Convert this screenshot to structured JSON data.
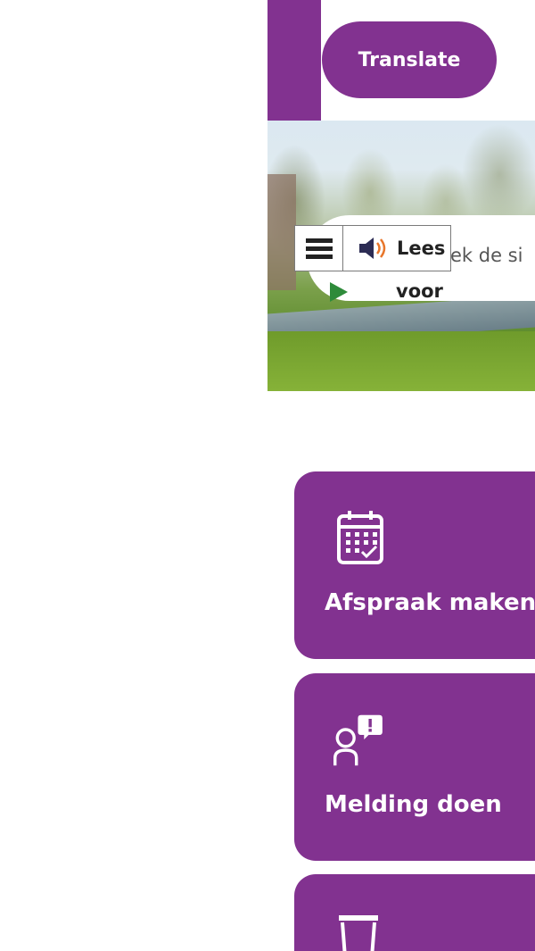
{
  "header": {
    "translate_label": "Translate"
  },
  "hero": {
    "search_placeholder": "ek de si"
  },
  "readspeaker": {
    "label_line1": "Lees",
    "label_line2": "voor"
  },
  "tiles": [
    {
      "label": "Afspraak maken",
      "icon": "calendar-icon"
    },
    {
      "label": "Melding doen",
      "icon": "person-alert-icon"
    },
    {
      "label": "",
      "icon": "trash-bin-icon"
    }
  ],
  "colors": {
    "brand_purple": "#823290",
    "play_green": "#2e8b3a"
  }
}
